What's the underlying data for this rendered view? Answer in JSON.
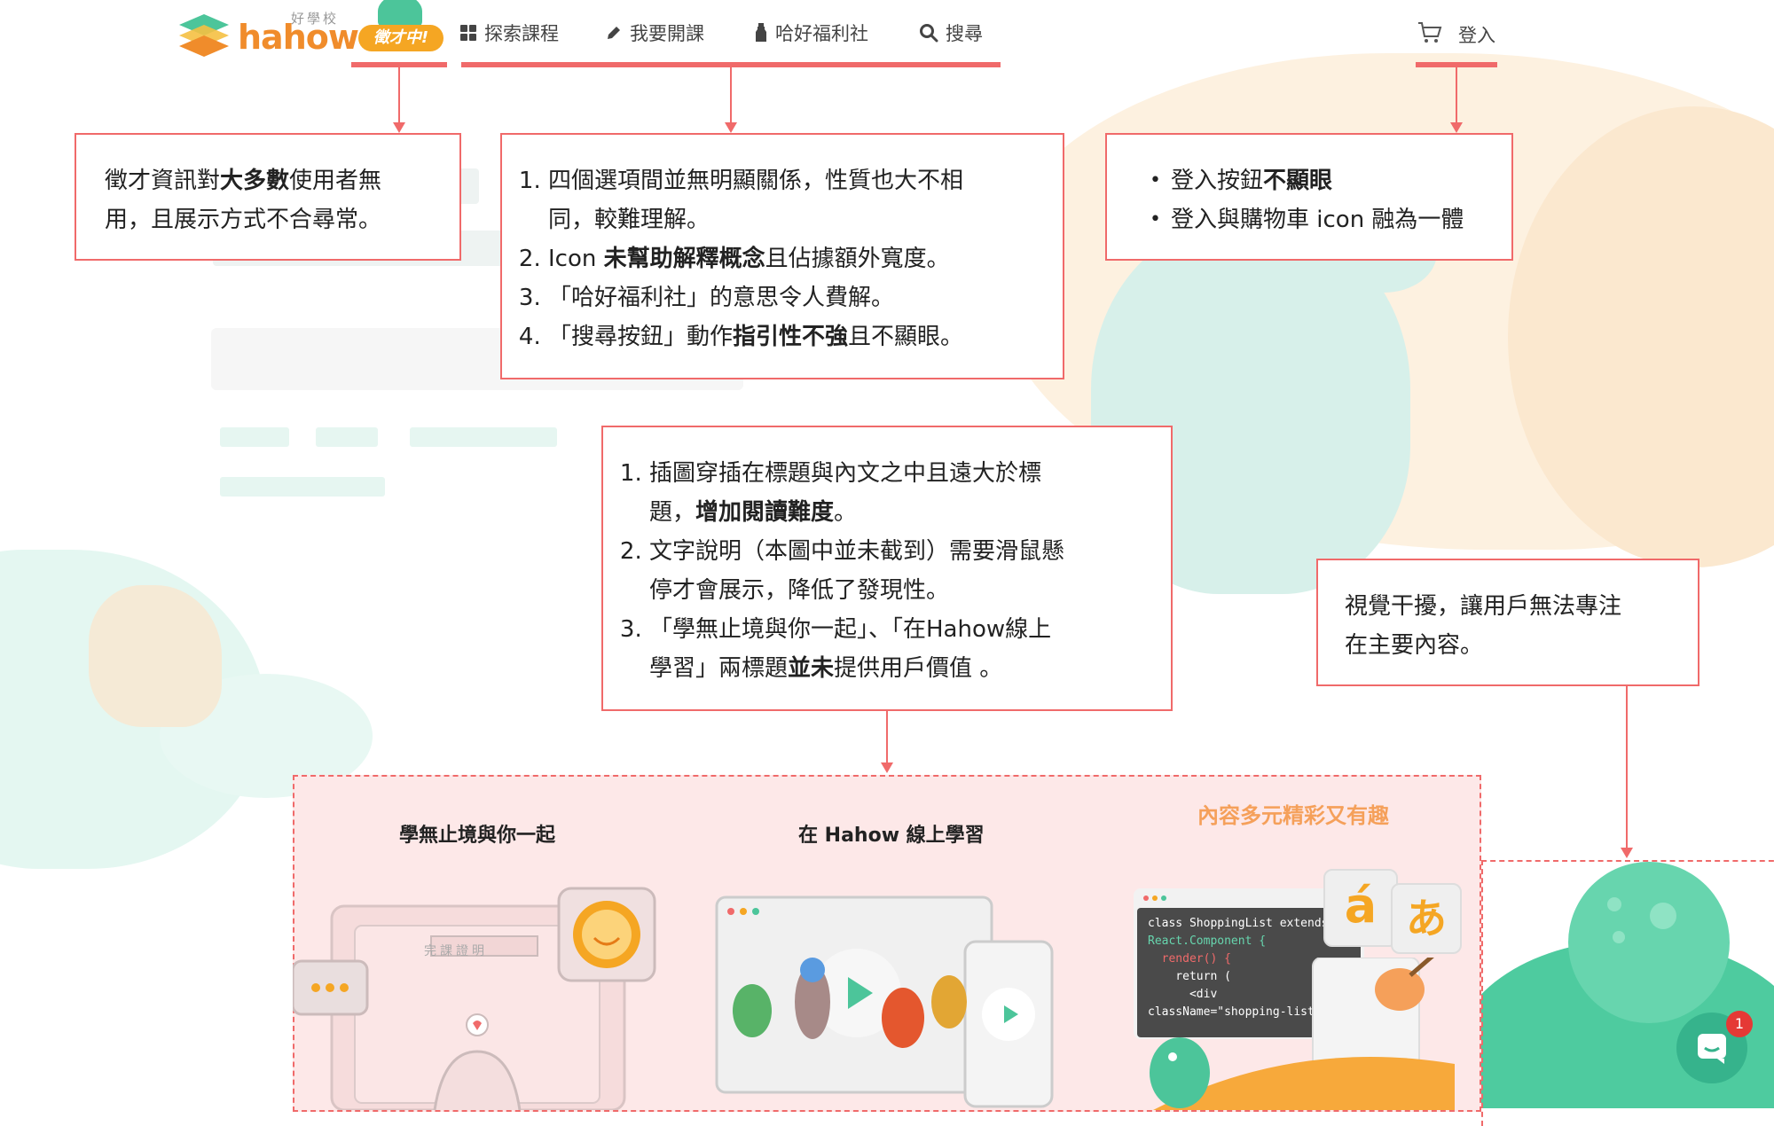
{
  "nav": {
    "logo_text": "hahow",
    "logo_sub": "好學校",
    "hiring_badge": "徵才中!",
    "items": [
      {
        "label": "探索課程",
        "icon": "grid-icon"
      },
      {
        "label": "我要開課",
        "icon": "pencil-icon"
      },
      {
        "label": "哈好福利社",
        "icon": "bottle-icon"
      },
      {
        "label": "搜尋",
        "icon": "search-icon"
      }
    ],
    "login_label": "登入",
    "cart_icon": "cart-icon"
  },
  "callouts": {
    "hiring": {
      "line1_a": "徵才資訊對",
      "line1_b": "大多數",
      "line1_c": "使用者無",
      "line2": "用，且展示方式不合尋常。"
    },
    "nav_items": {
      "item1_line1": "四個選項間並無明顯關係，性質也大不相",
      "item1_line2": "同，較難理解。",
      "item2_a": "Icon ",
      "item2_b": "未幫助解釋概念",
      "item2_c": "且佔據額外寬度。",
      "item3": "「哈好福利社」的意思令人費解。",
      "item4_a": "「搜尋按鈕」動作",
      "item4_b": "指引性不強",
      "item4_c": "且不顯眼。"
    },
    "login": {
      "item1_a": "登入按鈕",
      "item1_b": "不顯眼",
      "item2": "登入與購物車 icon 融為一體"
    },
    "section": {
      "item1_line1": "插圖穿插在標題與內文之中且遠大於標",
      "item1_line2_a": "題，",
      "item1_line2_b": "增加閱讀難度",
      "item1_line2_c": "。",
      "item2_line1": "文字說明（本圖中並未截到）需要滑鼠懸",
      "item2_line2": "停才會展示，降低了發現性。",
      "item3_line1": "「學無止境與你一起」、「在Hahow線上",
      "item3_line2_a": "學習」兩標題",
      "item3_line2_b": "並未",
      "item3_line2_c": "提供用戶價值 。"
    },
    "visual": {
      "line1": "視覺干擾，讓用戶無法專注",
      "line2": "在主要內容。"
    }
  },
  "section": {
    "title1": "學無止境與你一起",
    "title2": "在 Hahow 線上學習",
    "title3": "內容多元精彩又有趣",
    "certificate": "完課證明",
    "code_lines": [
      "class ShoppingList extends",
      "React.Component {",
      "  render() {",
      "    return (",
      "      <div",
      "className=\"shopping-list\">"
    ],
    "lang_glyph1": "á",
    "lang_glyph2": "あ"
  },
  "chat": {
    "badge_count": "1"
  },
  "colors": {
    "accent": "#f06a6a",
    "brand_orange": "#f08c2b",
    "brand_green": "#4cc59a",
    "section_bg": "#fde8e8"
  }
}
